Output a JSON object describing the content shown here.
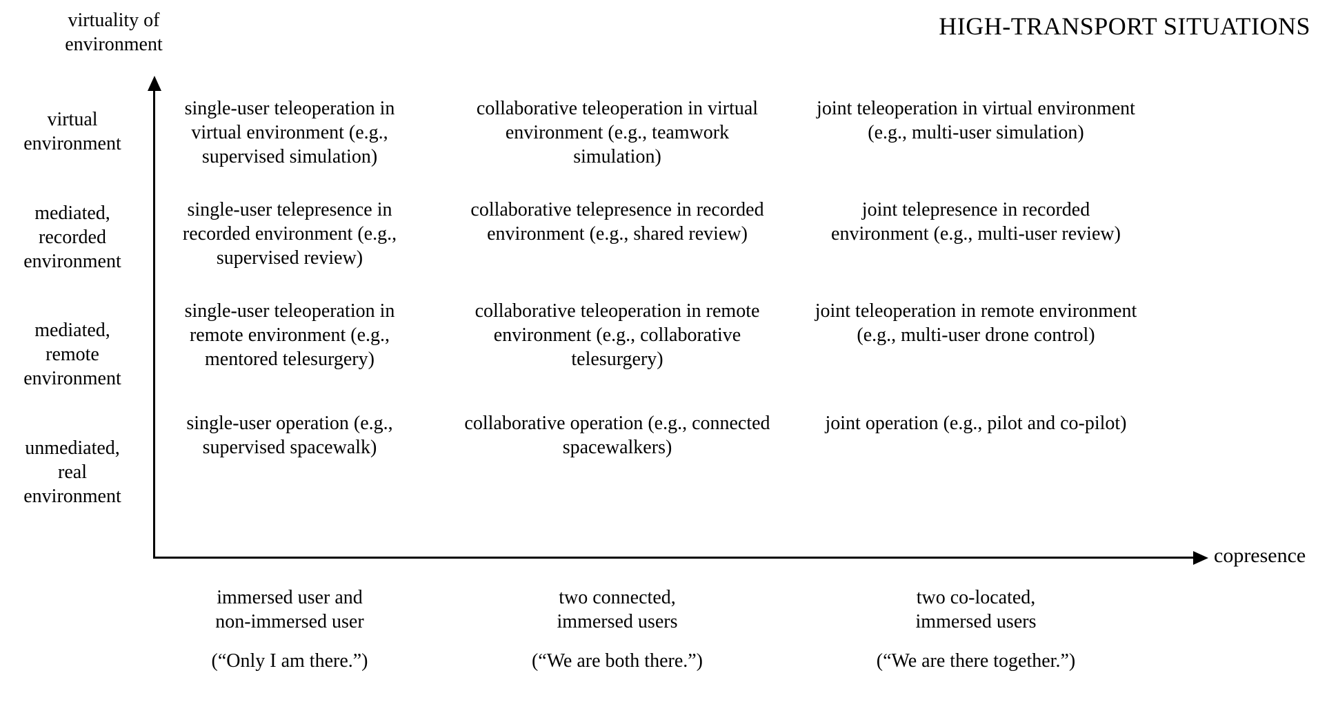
{
  "title": "HIGH-TRANSPORT SITUATIONS",
  "y_axis": {
    "label_line1": "virtuality of",
    "label_line2": "environment",
    "ticks": [
      {
        "l1": "virtual",
        "l2": "environment",
        "l3": ""
      },
      {
        "l1": "mediated,",
        "l2": "recorded",
        "l3": "environment"
      },
      {
        "l1": "mediated,",
        "l2": "remote",
        "l3": "environment"
      },
      {
        "l1": "unmediated,",
        "l2": "real",
        "l3": "environment"
      }
    ]
  },
  "x_axis": {
    "label": "copresence",
    "ticks": [
      {
        "l1": "immersed user and",
        "l2": "non-immersed user",
        "sub": "(“Only I am there.”)"
      },
      {
        "l1": "two connected,",
        "l2": "immersed users",
        "sub": "(“We are both there.”)"
      },
      {
        "l1": "two co-located,",
        "l2": "immersed users",
        "sub": "(“We are there together.”)"
      }
    ]
  },
  "cells": {
    "r0c0": {
      "l1": "single-user teleoperation",
      "l2": "in virtual environment",
      "l3": "(e.g., supervised simulation)"
    },
    "r0c1": {
      "l1": "collaborative teleoperation",
      "l2": "in virtual environment",
      "l3": "(e.g., teamwork simulation)"
    },
    "r0c2": {
      "l1": "joint teleoperation",
      "l2": "in virtual environment",
      "l3": "(e.g., multi-user simulation)"
    },
    "r1c0": {
      "l1": "single-user telepresence",
      "l2": "in recorded environment",
      "l3": "(e.g., supervised review)"
    },
    "r1c1": {
      "l1": "collaborative telepresence",
      "l2": "in recorded environment",
      "l3": "(e.g., shared review)"
    },
    "r1c2": {
      "l1": "joint telepresence",
      "l2": "in recorded environment",
      "l3": "(e.g., multi-user review)"
    },
    "r2c0": {
      "l1": "single-user teleoperation",
      "l2": "in remote environment",
      "l3": "(e.g., mentored telesurgery)"
    },
    "r2c1": {
      "l1": "collaborative teleoperation",
      "l2": "in remote environment",
      "l3": "(e.g., collaborative telesurgery)"
    },
    "r2c2": {
      "l1": "joint teleoperation",
      "l2": "in remote environment",
      "l3": "(e.g., multi-user drone control)"
    },
    "r3c0": {
      "l1": "single-user operation",
      "l2": "(e.g., supervised spacewalk)",
      "l3": ""
    },
    "r3c1": {
      "l1": "collaborative operation",
      "l2": "(e.g., connected spacewalkers)",
      "l3": ""
    },
    "r3c2": {
      "l1": "joint operation",
      "l2": "(e.g., pilot and co-pilot)",
      "l3": ""
    }
  },
  "chart_data": {
    "type": "table",
    "title": "HIGH-TRANSPORT SITUATIONS",
    "xlabel": "copresence",
    "ylabel": "virtuality of environment",
    "x_categories": [
      "immersed user and non-immersed user (“Only I am there.”)",
      "two connected, immersed users (“We are both there.”)",
      "two co-located, immersed users (“We are there together.”)"
    ],
    "y_categories": [
      "virtual environment",
      "mediated, recorded environment",
      "mediated, remote environment",
      "unmediated, real environment"
    ],
    "grid": [
      [
        "single-user teleoperation in virtual environment (e.g., supervised simulation)",
        "collaborative teleoperation in virtual environment (e.g., teamwork simulation)",
        "joint teleoperation in virtual environment (e.g., multi-user simulation)"
      ],
      [
        "single-user telepresence in recorded environment (e.g., supervised review)",
        "collaborative telepresence in recorded environment (e.g., shared review)",
        "joint telepresence in recorded environment (e.g., multi-user review)"
      ],
      [
        "single-user teleoperation in remote environment (e.g., mentored telesurgery)",
        "collaborative teleoperation in remote environment (e.g., collaborative telesurgery)",
        "joint teleoperation in remote environment (e.g., multi-user drone control)"
      ],
      [
        "single-user operation (e.g., supervised spacewalk)",
        "collaborative operation (e.g., connected spacewalkers)",
        "joint operation (e.g., pilot and co-pilot)"
      ]
    ]
  }
}
